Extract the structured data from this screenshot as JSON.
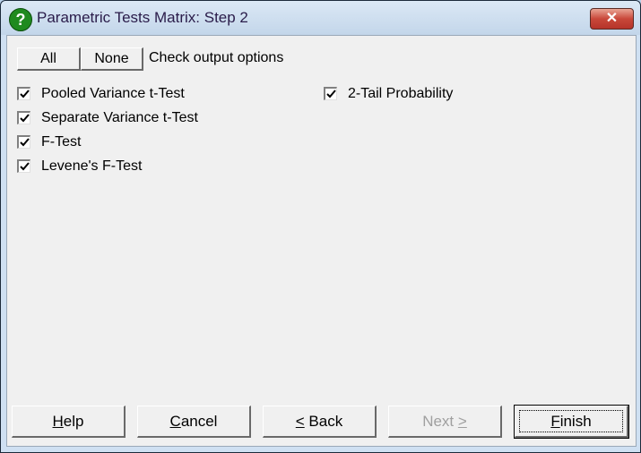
{
  "window": {
    "title": "Parametric Tests Matrix: Step 2",
    "icon": "help-question-icon",
    "close_icon": "close-icon",
    "close_glyph": "✕"
  },
  "toolbar": {
    "all_label": "All",
    "none_label": "None",
    "instruction": "Check output options"
  },
  "options_left": [
    {
      "label": "Pooled Variance t-Test",
      "checked": true
    },
    {
      "label": "Separate Variance t-Test",
      "checked": true
    },
    {
      "label": "F-Test",
      "checked": true
    },
    {
      "label": "Levene's F-Test",
      "checked": true
    }
  ],
  "options_right": [
    {
      "label": "2-Tail Probability",
      "checked": true
    }
  ],
  "footer": {
    "help": {
      "prefix": "",
      "mnemonic": "H",
      "rest": "elp"
    },
    "cancel": {
      "prefix": "",
      "mnemonic": "C",
      "rest": "ancel"
    },
    "back": {
      "prefix": "",
      "mnemonic": "<",
      "rest": " Back"
    },
    "next": {
      "prefix": "Next ",
      "mnemonic": ">",
      "rest": "",
      "disabled": true
    },
    "finish": {
      "prefix": "",
      "mnemonic": "F",
      "rest": "inish",
      "default": true
    }
  }
}
